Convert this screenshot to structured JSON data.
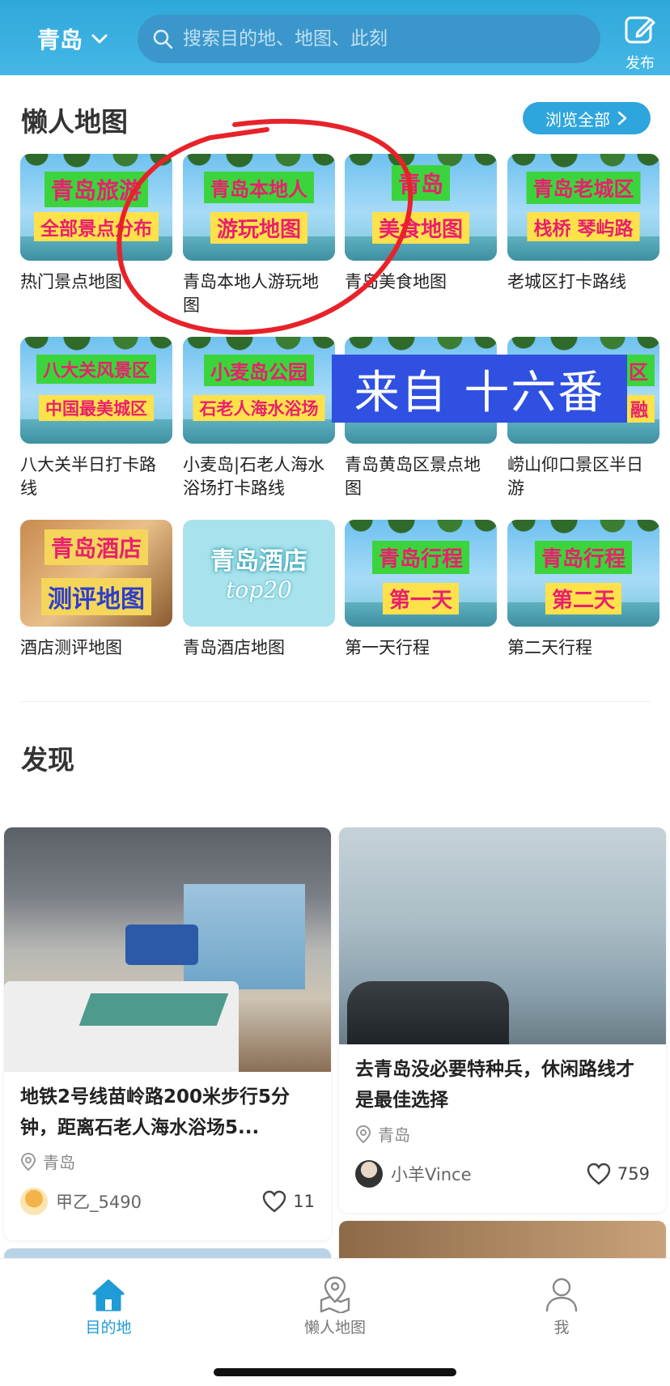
{
  "header": {
    "city": "青岛",
    "search_placeholder": "搜索目的地、地图、此刻",
    "publish_label": "发布"
  },
  "lazy_map": {
    "title": "懒人地图",
    "browse_all": "浏览全部",
    "tiles": [
      {
        "line1": "青岛旅游",
        "line2": "全部景点分布",
        "caption": "热门景点地图"
      },
      {
        "line1": "青岛本地人",
        "line2": "游玩地图",
        "caption": "青岛本地人游玩地图"
      },
      {
        "line1": "青岛",
        "line2": "美食地图",
        "caption": "青岛美食地图"
      },
      {
        "line1": "青岛老城区",
        "line2": "栈桥 琴屿路",
        "caption": "老城区打卡路线"
      },
      {
        "line1": "八大关风景区",
        "line2": "中国最美城区",
        "caption": "八大关半日打卡路线"
      },
      {
        "line1": "小麦岛公园",
        "line2": "石老人海水浴场",
        "caption": "小麦岛|石老人海水浴场打卡路线"
      },
      {
        "line1": "",
        "line2": "",
        "caption": "青岛黄岛区景点地图"
      },
      {
        "line1": "区",
        "line2": "融",
        "caption": "崂山仰口景区半日游"
      },
      {
        "line1": "青岛酒店",
        "line2": "测评地图",
        "caption": "酒店测评地图"
      },
      {
        "line1": "青岛酒店",
        "line2": "top20",
        "caption": "青岛酒店地图"
      },
      {
        "line1": "青岛行程",
        "line2": "第一天",
        "caption": "第一天行程"
      },
      {
        "line1": "青岛行程",
        "line2": "第二天",
        "caption": "第二天行程"
      }
    ],
    "watermark": "来自 十六番"
  },
  "discover": {
    "title": "发现",
    "cards": [
      {
        "title": "地铁2号线苗岭路200米步行5分钟，距离石老人海水浴场5...",
        "location": "青岛",
        "user": "甲乙_5490",
        "likes": "11"
      },
      {
        "title": "去青岛没必要特种兵，休闲路线才是最佳选择",
        "location": "青岛",
        "user": "小羊Vince",
        "likes": "759"
      }
    ]
  },
  "bottom_nav": {
    "items": [
      {
        "label": "目的地",
        "active": true
      },
      {
        "label": "懒人地图",
        "active": false
      },
      {
        "label": "我",
        "active": false
      }
    ]
  },
  "colors": {
    "accent": "#1f9bd6",
    "header": "#36abde",
    "watermark": "#2f50e0"
  }
}
